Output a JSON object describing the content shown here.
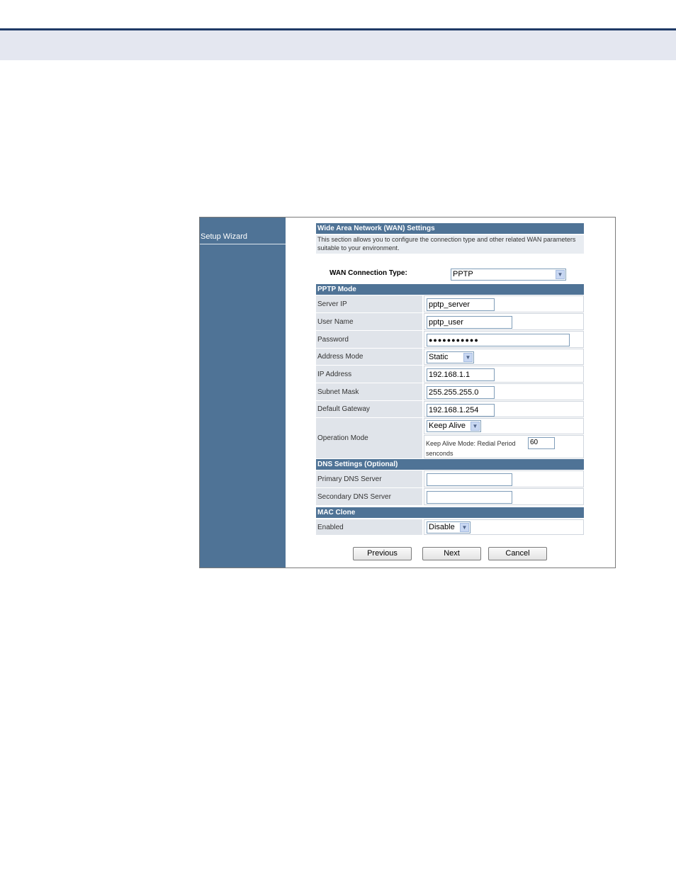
{
  "sidebar": {
    "items": [
      {
        "label": "Setup Wizard"
      }
    ]
  },
  "wan": {
    "title": "Wide Area Network (WAN) Settings",
    "description": "This section allows you to configure the connection type and other related WAN parameters suitable to your environment.",
    "connection_type_label": "WAN Connection Type:",
    "connection_type_value": "PPTP"
  },
  "pptp": {
    "title": "PPTP Mode",
    "server_ip_label": "Server IP",
    "server_ip_value": "pptp_server",
    "user_name_label": "User Name",
    "user_name_value": "pptp_user",
    "password_label": "Password",
    "password_value": "●●●●●●●●●●●",
    "address_mode_label": "Address Mode",
    "address_mode_value": "Static",
    "ip_address_label": "IP Address",
    "ip_address_value": "192.168.1.1",
    "subnet_mask_label": "Subnet Mask",
    "subnet_mask_value": "255.255.255.0",
    "default_gateway_label": "Default Gateway",
    "default_gateway_value": "192.168.1.254",
    "operation_mode_label": "Operation Mode",
    "operation_mode_value": "Keep Alive",
    "redial_label": "Keep Alive Mode: Redial Period",
    "redial_value": "60",
    "redial_unit": "senconds"
  },
  "dns": {
    "title": "DNS Settings (Optional)",
    "primary_label": "Primary DNS Server",
    "primary_value": "",
    "secondary_label": "Secondary DNS Server",
    "secondary_value": ""
  },
  "mac": {
    "title": "MAC Clone",
    "enabled_label": "Enabled",
    "enabled_value": "Disable"
  },
  "buttons": {
    "previous": "Previous",
    "next": "Next",
    "cancel": "Cancel"
  },
  "icons": {
    "dropdown": "chevron-down-icon"
  },
  "colors": {
    "accent": "#4f7396",
    "top_rule": "#1f3a66",
    "top_band": "#e4e7f0"
  }
}
